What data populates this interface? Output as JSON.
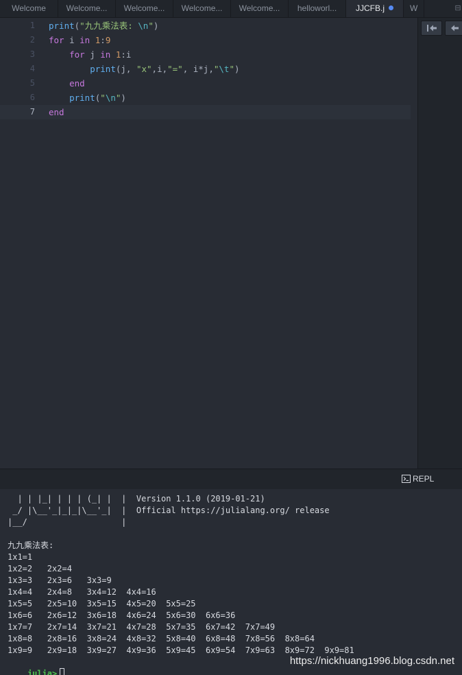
{
  "tabs": [
    {
      "label": "Welcome"
    },
    {
      "label": "Welcome..."
    },
    {
      "label": "Welcome..."
    },
    {
      "label": "Welcome..."
    },
    {
      "label": "Welcome..."
    },
    {
      "label": "helloworl..."
    },
    {
      "label": "JJCFB.j",
      "active": true,
      "modified": true
    },
    {
      "label": "W"
    }
  ],
  "editor": {
    "line_numbers": [
      "1",
      "2",
      "3",
      "4",
      "5",
      "6",
      "7"
    ],
    "current_line": 7
  },
  "right_panel": {
    "buttons": [
      {
        "icon": "jump-to-start-icon"
      },
      {
        "icon": "back-arrow-icon"
      }
    ]
  },
  "repl": {
    "tab_label": "REPL",
    "banner": [
      "  | | |_| | | | (_| |  |  Version 1.1.0 (2019-01-21)",
      " _/ |\\__'_|_|_|\\__'_|  |  Official https://julialang.org/ release",
      "|__/                   |"
    ],
    "output": [
      "九九乘法表:",
      "1x1=1",
      "1x2=2   2x2=4",
      "1x3=3   2x3=6   3x3=9",
      "1x4=4   2x4=8   3x4=12  4x4=16",
      "1x5=5   2x5=10  3x5=15  4x5=20  5x5=25",
      "1x6=6   2x6=12  3x6=18  4x6=24  5x6=30  6x6=36",
      "1x7=7   2x7=14  3x7=21  4x7=28  5x7=35  6x7=42  7x7=49",
      "1x8=8   2x8=16  3x8=24  4x8=32  5x8=40  6x8=48  7x8=56  8x8=64",
      "1x9=9   2x9=18  3x9=27  4x9=36  5x9=45  6x9=54  7x9=63  8x9=72  9x9=81"
    ],
    "prompt": "julia>"
  },
  "watermark": "https://nickhuang1996.blog.csdn.net",
  "colors": {
    "background": "#282c34",
    "keyword": "#c678dd",
    "function": "#61afef",
    "string": "#98c379",
    "number": "#d19a66",
    "prompt": "#4ec24e",
    "modified_dot": "#568af2"
  }
}
